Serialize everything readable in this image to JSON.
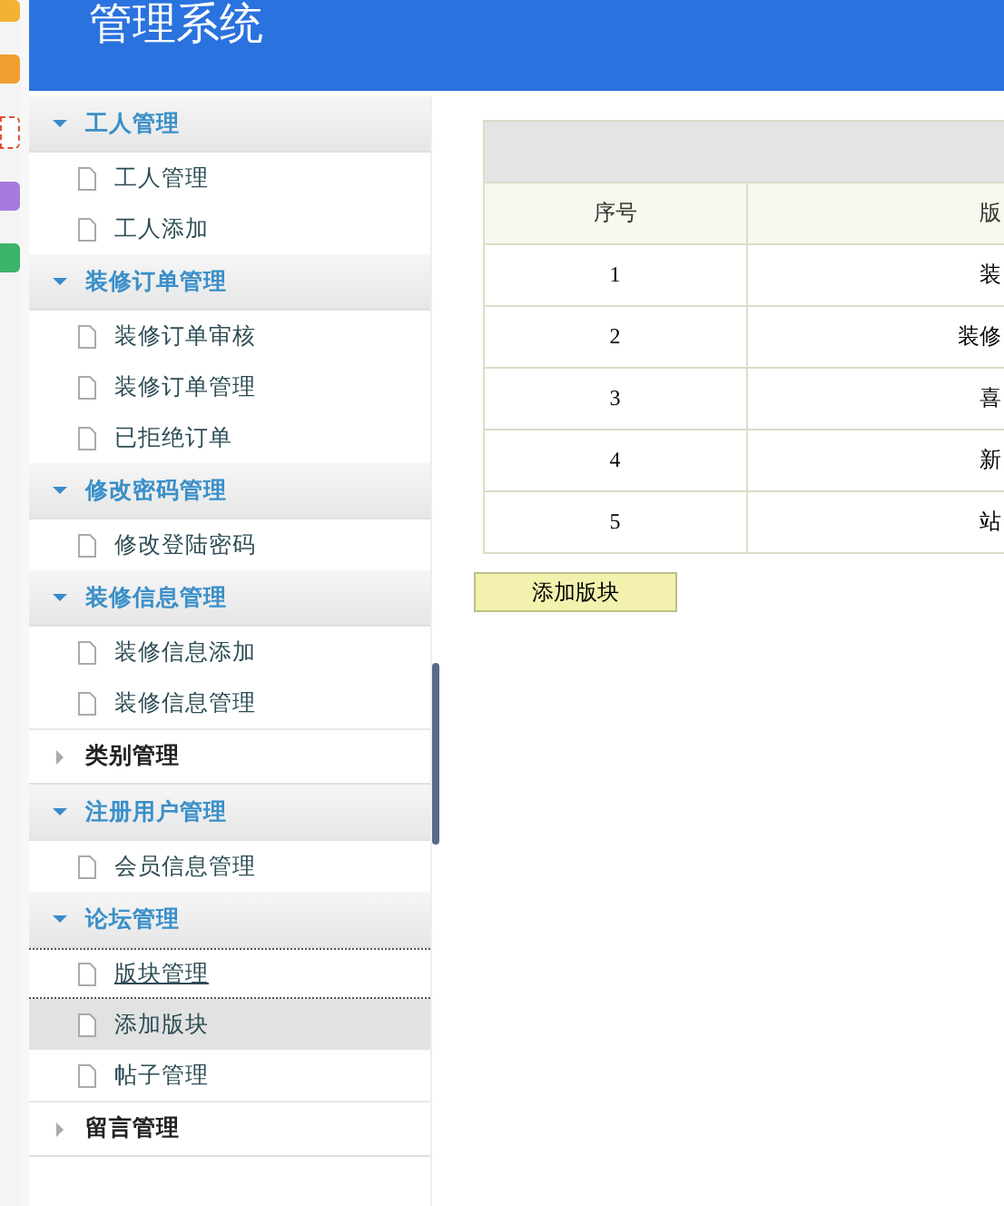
{
  "header": {
    "title": "管理系统"
  },
  "sidebar": {
    "groups": [
      {
        "label": "工人管理",
        "expanded": true,
        "items": [
          {
            "label": "工人管理",
            "selected": false,
            "focused": false
          },
          {
            "label": "工人添加",
            "selected": false,
            "focused": false
          }
        ]
      },
      {
        "label": "装修订单管理",
        "expanded": true,
        "items": [
          {
            "label": "装修订单审核",
            "selected": false,
            "focused": false
          },
          {
            "label": "装修订单管理",
            "selected": false,
            "focused": false
          },
          {
            "label": "已拒绝订单",
            "selected": false,
            "focused": false
          }
        ]
      },
      {
        "label": "修改密码管理",
        "expanded": true,
        "items": [
          {
            "label": "修改登陆密码",
            "selected": false,
            "focused": false
          }
        ]
      },
      {
        "label": "装修信息管理",
        "expanded": true,
        "items": [
          {
            "label": "装修信息添加",
            "selected": false,
            "focused": false
          },
          {
            "label": "装修信息管理",
            "selected": false,
            "focused": false
          }
        ]
      },
      {
        "label": "类别管理",
        "expanded": false
      },
      {
        "label": "注册用户管理",
        "expanded": true,
        "items": [
          {
            "label": "会员信息管理",
            "selected": false,
            "focused": false
          }
        ]
      },
      {
        "label": "论坛管理",
        "expanded": true,
        "items": [
          {
            "label": "版块管理",
            "selected": false,
            "focused": true
          },
          {
            "label": "添加版块",
            "selected": true,
            "focused": false
          },
          {
            "label": "帖子管理",
            "selected": false,
            "focused": false
          }
        ]
      },
      {
        "label": "留言管理",
        "expanded": false
      }
    ]
  },
  "table": {
    "columns": [
      "序号",
      "版"
    ],
    "rows": [
      [
        "1",
        "装"
      ],
      [
        "2",
        "装修"
      ],
      [
        "3",
        "喜"
      ],
      [
        "4",
        "新"
      ],
      [
        "5",
        "站"
      ]
    ]
  },
  "add_button": "添加版块"
}
